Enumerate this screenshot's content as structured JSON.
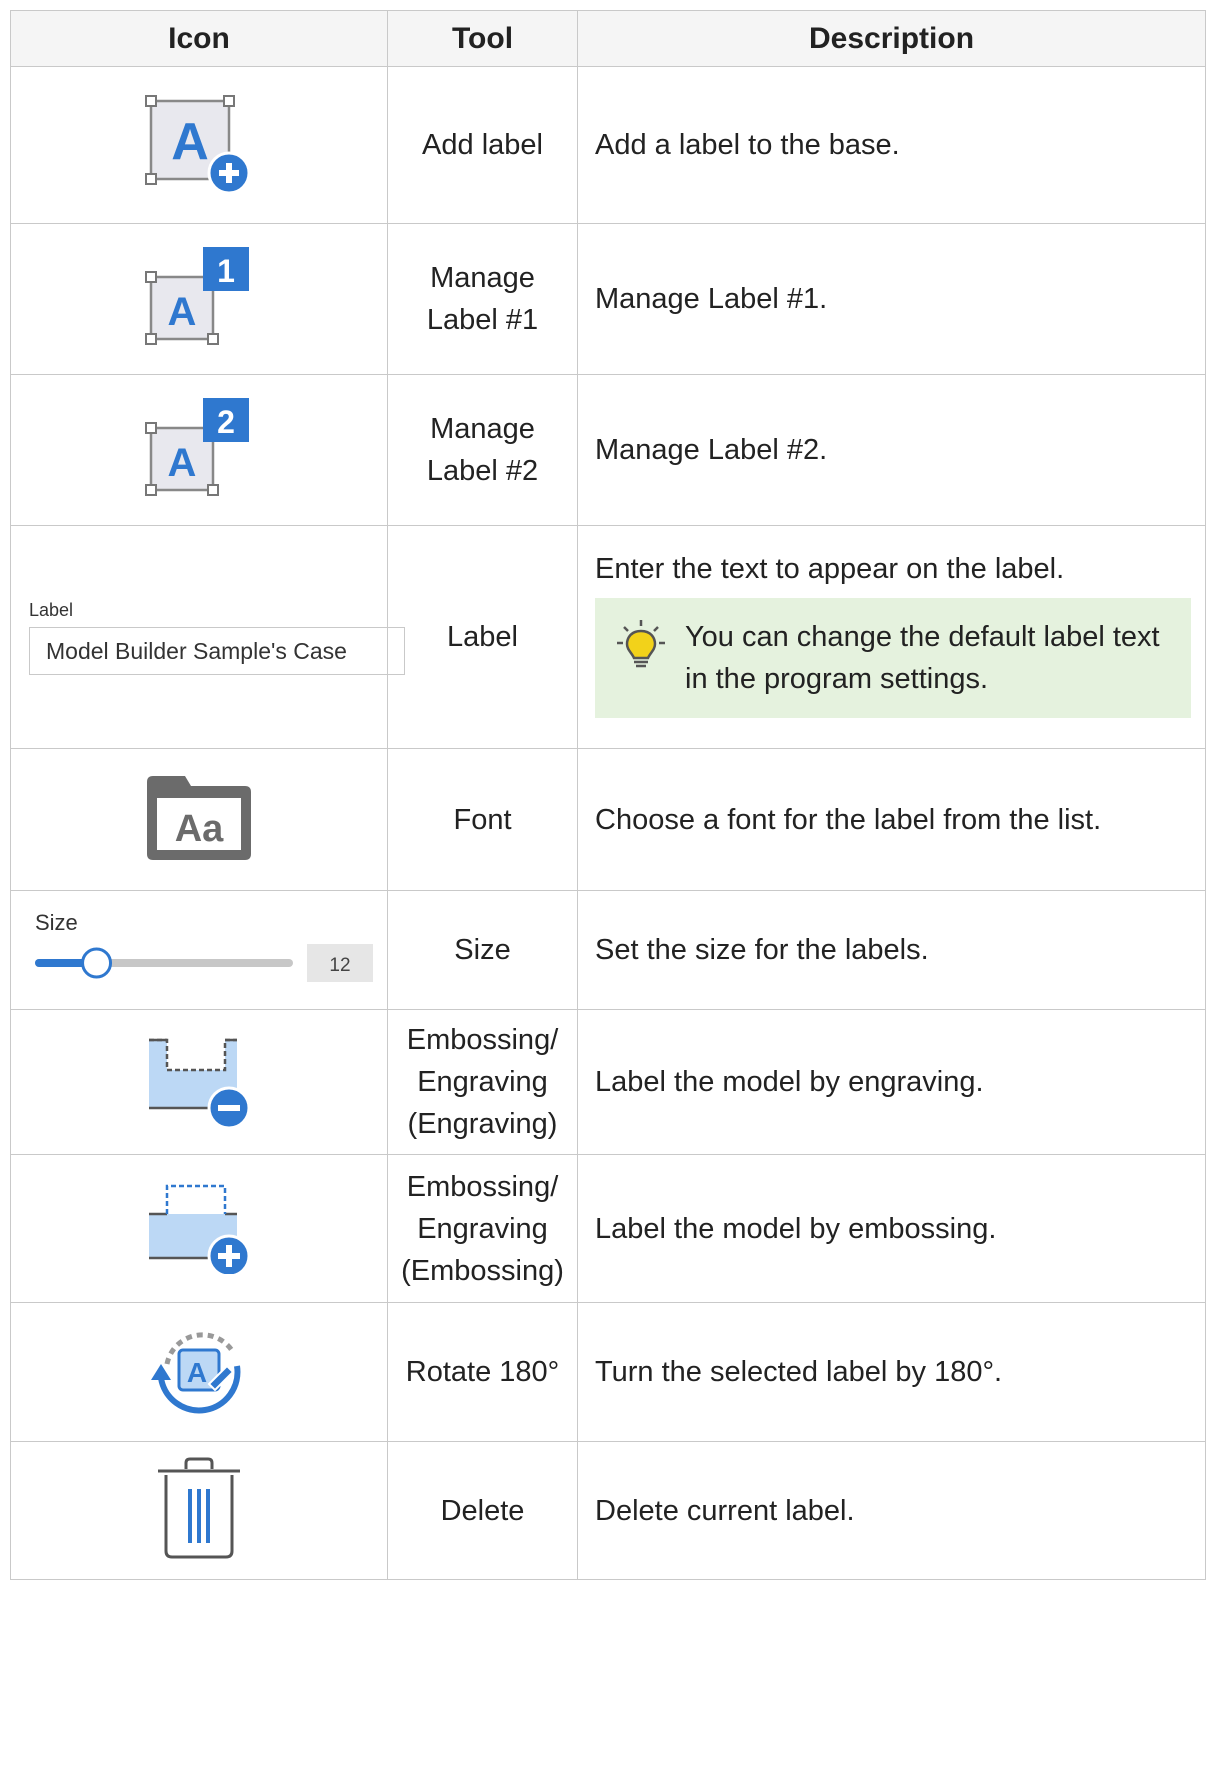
{
  "headers": {
    "icon": "Icon",
    "tool": "Tool",
    "description": "Description"
  },
  "rows": [
    {
      "tool": "Add label",
      "description": "Add a label to the base."
    },
    {
      "tool": "Manage Label #1",
      "description": "Manage Label #1."
    },
    {
      "tool": "Manage Label #2",
      "description": "Manage Label #2."
    },
    {
      "tool": "Label",
      "description": "Enter the text to appear on the label.",
      "tip": "You can change the default label text in the program settings."
    },
    {
      "tool": "Font",
      "description": "Choose a font for the label from the list."
    },
    {
      "tool": "Size",
      "description": "Set the size for the labels."
    },
    {
      "tool": "Embossing/ Engraving (Engraving)",
      "description": "Label the model by engraving."
    },
    {
      "tool": "Embossing/ Engraving (Embossing)",
      "description": "Label the model by embossing."
    },
    {
      "tool": "Rotate 180°",
      "description": "Turn the selected label by 180°."
    },
    {
      "tool": "Delete",
      "description": "Delete current label."
    }
  ],
  "icons": {
    "manage_label_1_badge": "1",
    "manage_label_2_badge": "2",
    "add_label_letter": "A",
    "font_icon_text": "Aa"
  },
  "label_widget": {
    "label": "Label",
    "value": "Model Builder Sample's Case"
  },
  "size_widget": {
    "label": "Size",
    "value": "12",
    "level": 0.13
  },
  "colors": {
    "accent": "#2f78cf",
    "icon_fill": "#e8e8ee",
    "tip_bg": "#e5f2de",
    "light_blue": "#bcd8f5",
    "dark_gray": "#6b6b6b"
  }
}
